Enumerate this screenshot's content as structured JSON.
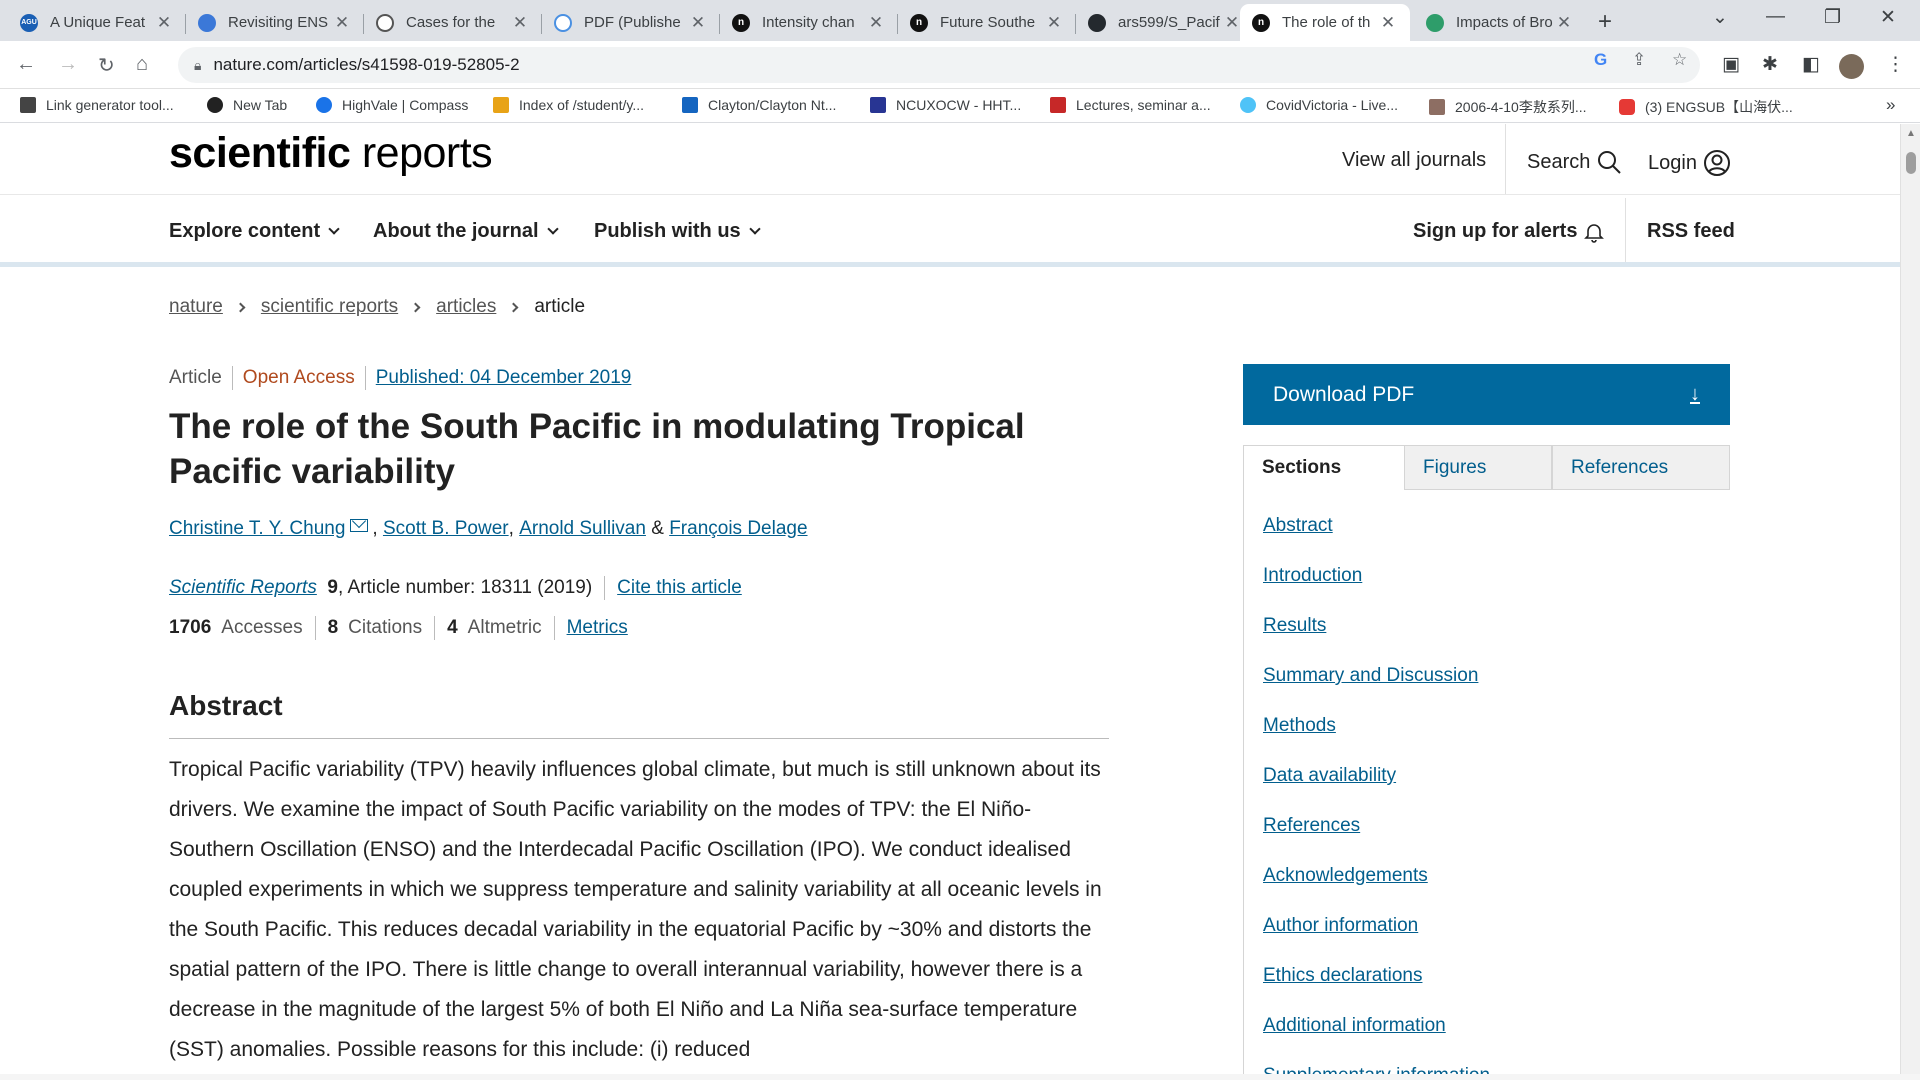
{
  "browser": {
    "tabs": [
      {
        "title": "A Unique Feat",
        "favicon": "agu-icon",
        "fav_text": "AGU"
      },
      {
        "title": "Revisiting ENS",
        "favicon": "globe-icon",
        "fav_text": ""
      },
      {
        "title": "Cases for the",
        "favicon": "document-icon",
        "fav_text": ""
      },
      {
        "title": "PDF (Publishe",
        "favicon": "pdf-icon",
        "fav_text": ""
      },
      {
        "title": "Intensity chan",
        "favicon": "nature-icon",
        "fav_text": "n"
      },
      {
        "title": "Future Southe",
        "favicon": "nature-icon",
        "fav_text": "n"
      },
      {
        "title": "ars599/S_Pacif",
        "favicon": "github-icon",
        "fav_text": ""
      },
      {
        "title": "The role of th",
        "favicon": "nature-icon",
        "fav_text": "n"
      },
      {
        "title": "Impacts of Bro",
        "favicon": "globe-icon",
        "fav_text": ""
      }
    ],
    "new_tab": "+",
    "url": "nature.com/articles/s41598-019-52805-2",
    "bookmarks": [
      {
        "label": "Link generator tool...",
        "color": "#444444"
      },
      {
        "label": "New Tab",
        "color": "#222222"
      },
      {
        "label": "HighVale | Compass",
        "color": "#1a73e8"
      },
      {
        "label": "Index of /student/y...",
        "color": "#e8a317"
      },
      {
        "label": "Clayton/Clayton Nt...",
        "color": "#1565c0"
      },
      {
        "label": "NCUXOCW - HHT...",
        "color": "#283593"
      },
      {
        "label": "Lectures, seminar a...",
        "color": "#c62828"
      },
      {
        "label": "CovidVictoria - Live...",
        "color": "#4fc3f7"
      },
      {
        "label": "2006-4-10李敖系列...",
        "color": "#8d6e63"
      },
      {
        "label": "(3) ENGSUB【山海伏...",
        "color": "#e53935"
      }
    ],
    "bookmarks_more": "»"
  },
  "site": {
    "brand_bold": "scientific",
    "brand_light": " reports",
    "view_all": "View all journals",
    "search": "Search",
    "login": "Login",
    "menu": [
      "Explore content",
      "About the journal",
      "Publish with us"
    ],
    "alerts": "Sign up for alerts",
    "rss": "RSS feed"
  },
  "breadcrumb": [
    "nature",
    "scientific reports",
    "articles",
    "article"
  ],
  "article": {
    "type": "Article",
    "access": "Open Access",
    "published": "Published: 04 December 2019",
    "title": "The role of the South Pacific in modulating Tropical Pacific variability",
    "authors": [
      "Christine T. Y. Chung",
      "Scott B. Power",
      "Arnold Sullivan",
      "François Delage"
    ],
    "author_sep_1": ",",
    "author_sep_2": ",",
    "author_sep_3": "&",
    "journal": "Scientific Reports",
    "volume": "9",
    "article_number": ", Article number: 18311 (2019)",
    "cite": "Cite this article",
    "accesses_n": "1706",
    "accesses_l": "Accesses",
    "citations_n": "8",
    "citations_l": "Citations",
    "altmetric_n": "4",
    "altmetric_l": "Altmetric",
    "metrics": "Metrics",
    "abstract_heading": "Abstract",
    "abstract": "Tropical Pacific variability (TPV) heavily influences global climate, but much is still unknown about its drivers. We examine the impact of South Pacific variability on the modes of TPV: the El Niño-Southern Oscillation (ENSO) and the Interdecadal Pacific Oscillation (IPO). We conduct idealised coupled experiments in which we suppress temperature and salinity variability at all oceanic levels in the South Pacific. This reduces decadal variability in the equatorial Pacific by ~30% and distorts the spatial pattern of the IPO. There is little change to overall interannual variability, however there is a decrease in the magnitude of the largest 5% of both El Niño and La Niña sea-surface temperature (SST) anomalies. Possible reasons for this include: (i) reduced"
  },
  "sidebar": {
    "download": "Download PDF",
    "tabs": [
      "Sections",
      "Figures",
      "References"
    ],
    "sections": [
      "Abstract",
      "Introduction",
      "Results",
      "Summary and Discussion",
      "Methods",
      "Data availability",
      "References",
      "Acknowledgements",
      "Author information",
      "Ethics declarations",
      "Additional information",
      "Supplementary information"
    ]
  }
}
